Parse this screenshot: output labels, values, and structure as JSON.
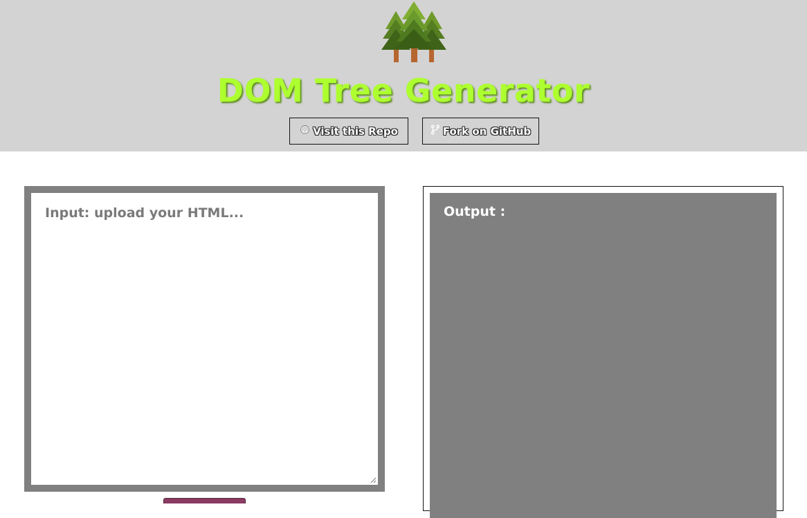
{
  "header": {
    "logo_icon": "pine-trees-icon",
    "title": "DOM Tree Generator",
    "buttons": [
      {
        "icon": "github-icon",
        "label": "Visit this Repo"
      },
      {
        "icon": "fork-icon",
        "label": "Fork on GitHub"
      }
    ]
  },
  "input": {
    "placeholder": "Input: upload your HTML...",
    "value": ""
  },
  "output": {
    "label": "Output :"
  },
  "colors": {
    "header_bg": "#d3d3d3",
    "title": "#adff2f",
    "panel_gray": "#808080",
    "submit_button": "#8b3a62"
  }
}
